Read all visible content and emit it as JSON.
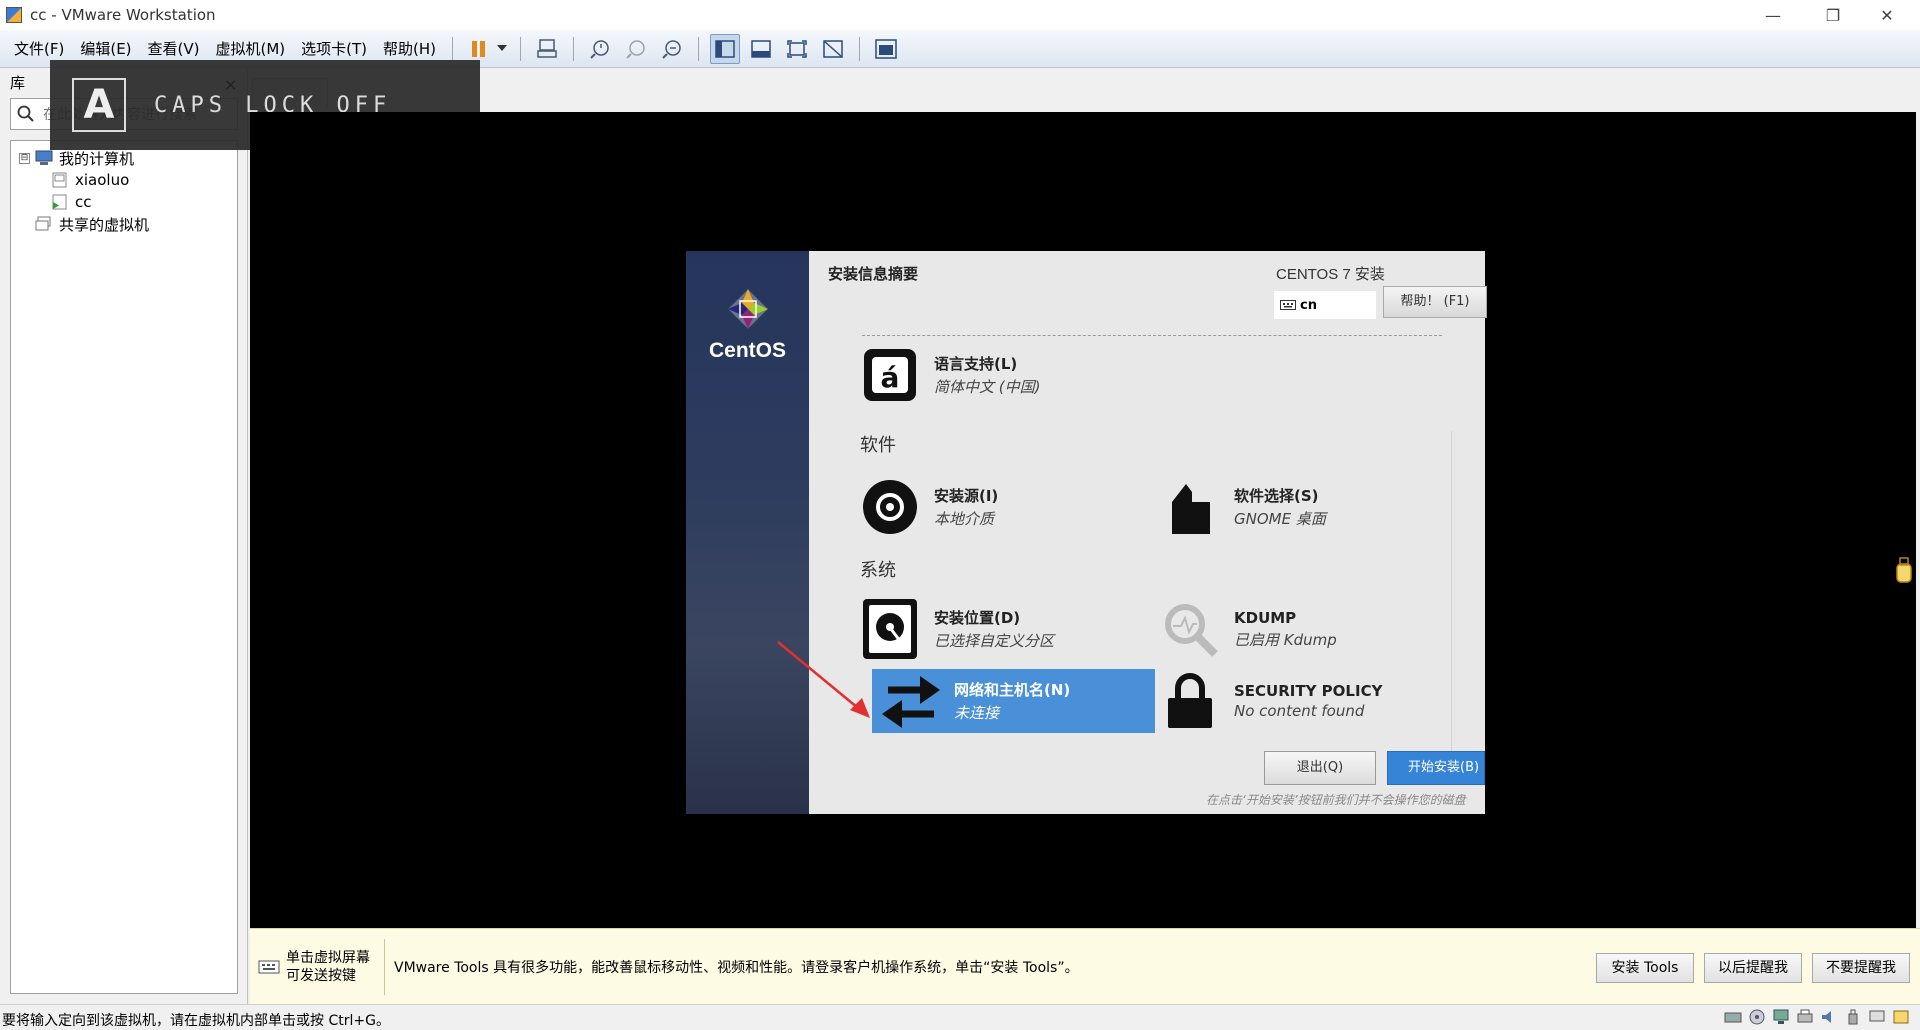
{
  "window": {
    "title": "cc - VMware Workstation",
    "controls": [
      "minimize",
      "restore",
      "close"
    ]
  },
  "menu": {
    "items": [
      "文件(F)",
      "编辑(E)",
      "查看(V)",
      "虚拟机(M)",
      "选项卡(T)",
      "帮助(H)"
    ]
  },
  "toolbar": {
    "icons": [
      "pause-icon",
      "dropdown-arrow-icon",
      "send-ctrl-alt-del-icon",
      "snapshot-icon",
      "snapshot-restore-icon",
      "snapshot-manager-icon",
      "show-library-icon",
      "thumbnail-bar-icon",
      "fullscreen-icon",
      "unity-icon",
      "console-view-icon"
    ]
  },
  "library": {
    "header": "库",
    "search_placeholder": "在此处键入内容进行搜索",
    "tree": [
      {
        "label": "我的计算机",
        "level": 0,
        "expander": "⊟"
      },
      {
        "label": "xiaoluo",
        "level": 1
      },
      {
        "label": "cc",
        "level": 1
      },
      {
        "label": "共享的虚拟机",
        "level": 0
      }
    ]
  },
  "caps_overlay": {
    "letter": "A",
    "text": "CAPS LOCK OFF",
    "close": "×"
  },
  "installer": {
    "title": "安装信息摘要",
    "product": "CENTOS 7 安装",
    "keyboard": "cn",
    "help_button": "帮助！ (F1)",
    "brand": "CentOS",
    "sections": {
      "software": "软件",
      "system": "系统"
    },
    "spokes": {
      "language": {
        "title": "语言支持(L)",
        "status": "简体中文 (中国)"
      },
      "source": {
        "title": "安装源(I)",
        "status": "本地介质"
      },
      "software_selection": {
        "title": "软件选择(S)",
        "status": "GNOME 桌面"
      },
      "destination": {
        "title": "安装位置(D)",
        "status": "已选择自定义分区"
      },
      "kdump": {
        "title": "KDUMP",
        "status": "已启用 Kdump"
      },
      "network": {
        "title": "网络和主机名(N)",
        "status": "未连接"
      },
      "security": {
        "title": "SECURITY POLICY",
        "status": "No content found"
      }
    },
    "quit_button": "退出(Q)",
    "begin_button": "开始安装(B)",
    "note": "在点击‘开始安装’按钮前我们并不会操作您的磁盘"
  },
  "notification": {
    "hint": "单击虚拟屏幕\n可发送按键",
    "message": "VMware Tools 具有很多功能，能改善鼠标移动性、视频和性能。请登录客户机操作系统，单击“安装 Tools”。",
    "buttons": {
      "install": "安装 Tools",
      "later": "以后提醒我",
      "never": "不要提醒我"
    }
  },
  "statusbar": {
    "text": "要将输入定向到该虚拟机，请在虚拟机内部单击或按 Ctrl+G。",
    "icons": [
      "hdd-icon",
      "cdrom-icon",
      "network-icon",
      "printer-icon",
      "sound-icon",
      "usb-icon",
      "display-icon",
      "message-icon"
    ]
  },
  "colors": {
    "selected_spoke": "#4a90d9",
    "begin_button": "#3584d8",
    "arrow": "#e03030",
    "notify_bg": "#fdfbe4"
  }
}
